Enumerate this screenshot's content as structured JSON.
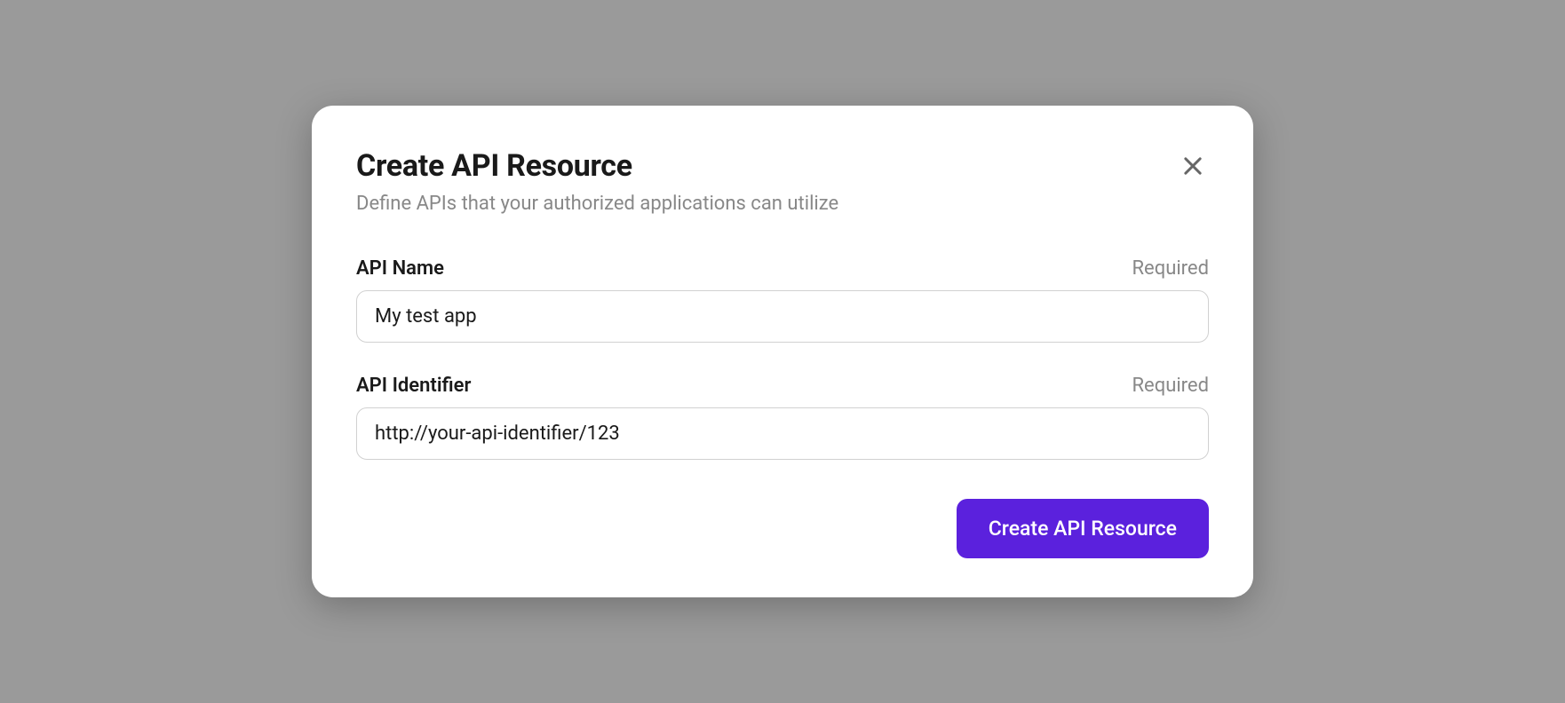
{
  "modal": {
    "title": "Create API Resource",
    "subtitle": "Define APIs that your authorized applications can utilize",
    "fields": {
      "apiName": {
        "label": "API Name",
        "required": "Required",
        "value": "My test app"
      },
      "apiIdentifier": {
        "label": "API Identifier",
        "required": "Required",
        "value": "http://your-api-identifier/123"
      }
    },
    "submitLabel": "Create API Resource"
  }
}
